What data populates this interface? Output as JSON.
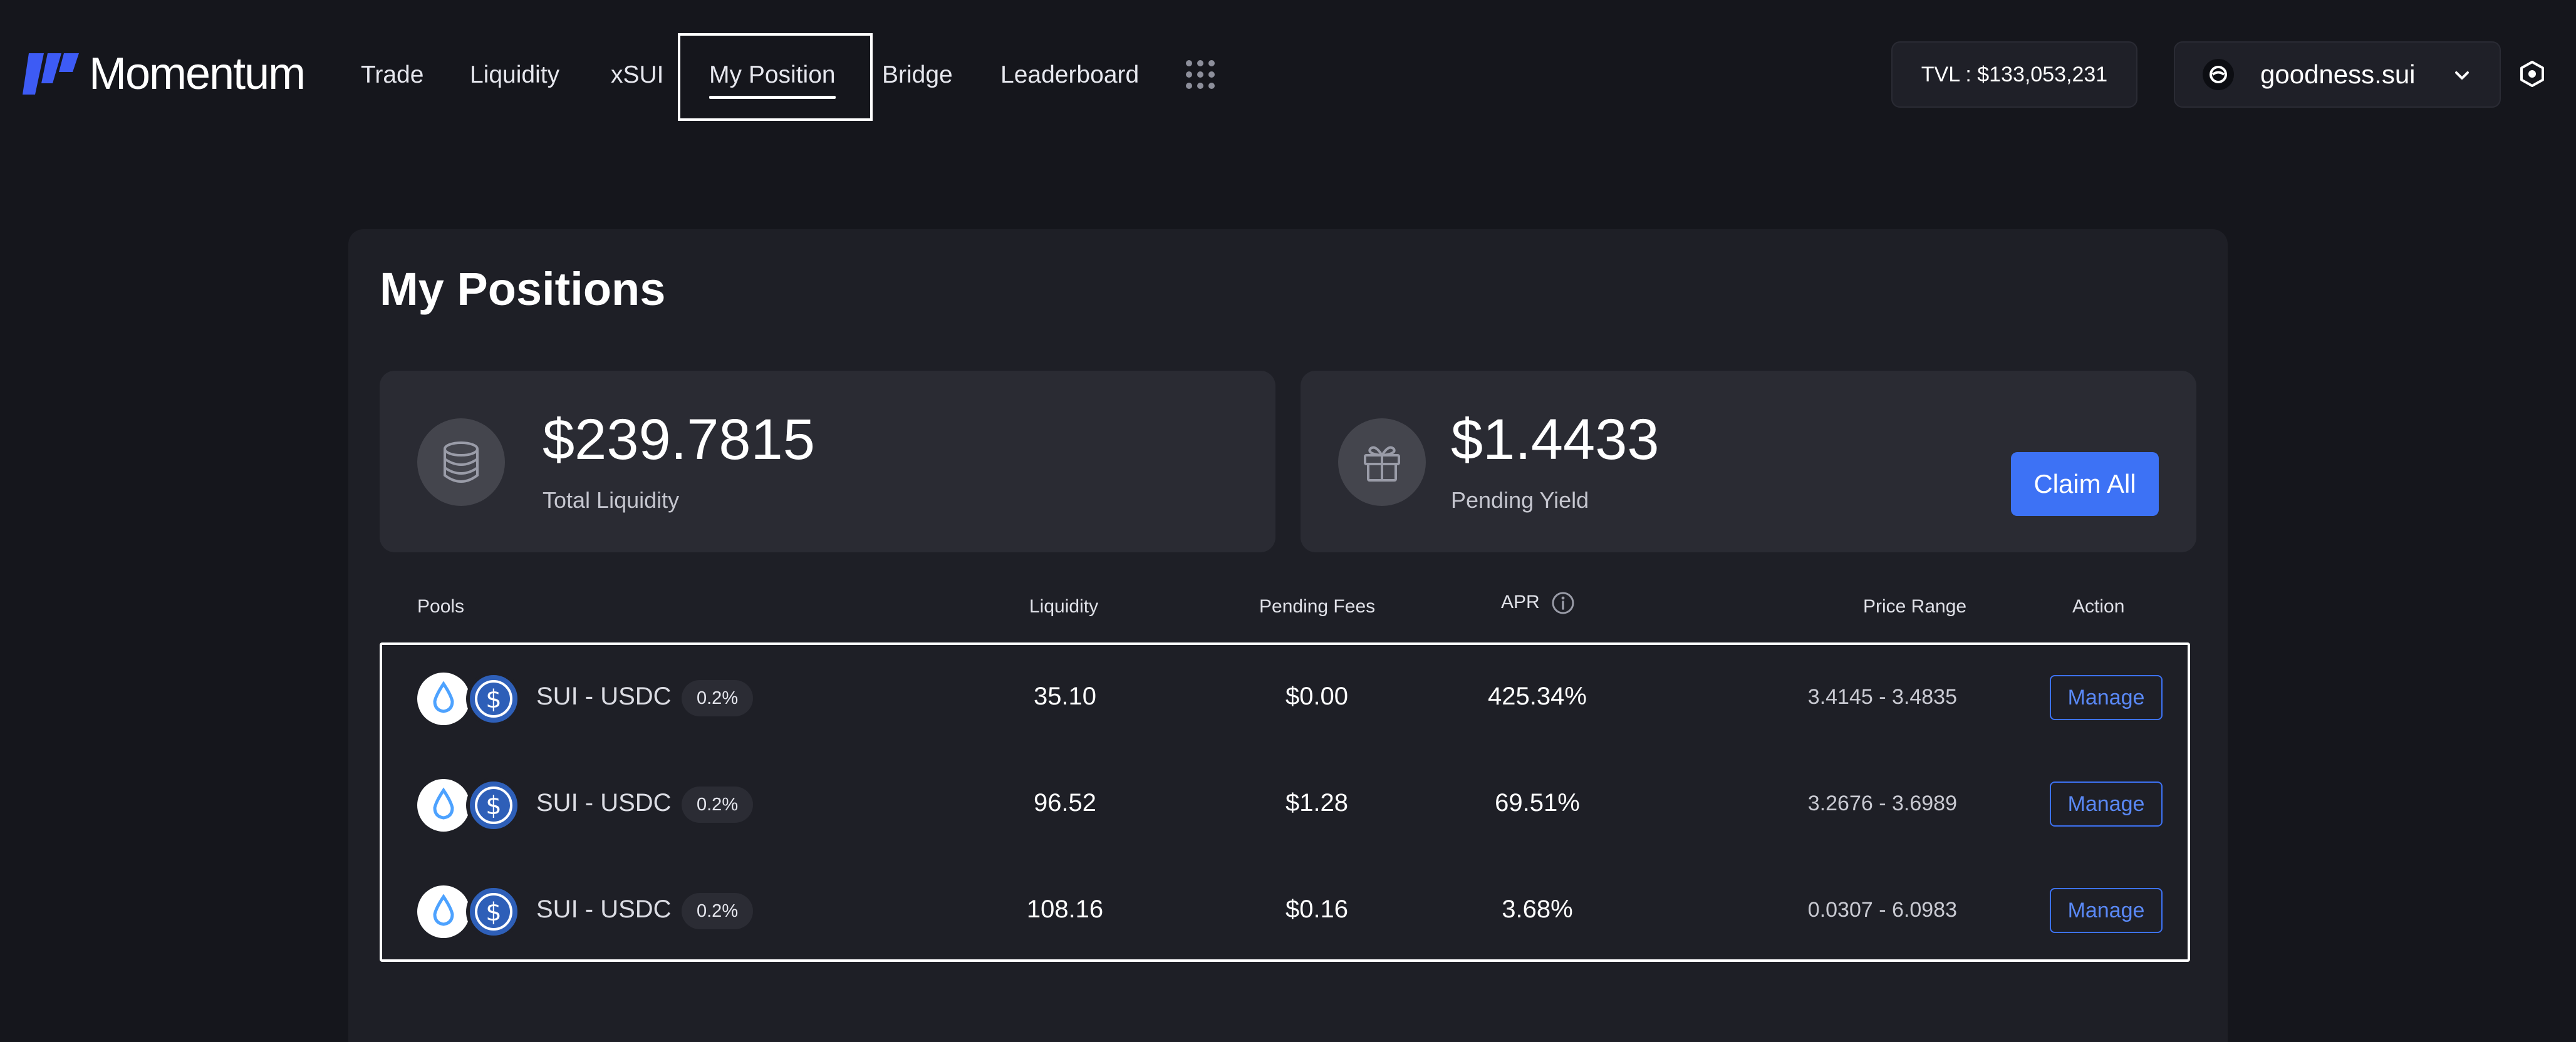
{
  "brand": {
    "name": "Momentum"
  },
  "nav": {
    "items": [
      "Trade",
      "Liquidity",
      "xSUI",
      "My Position",
      "Bridge",
      "Leaderboard"
    ],
    "active": "My Position"
  },
  "header": {
    "tvl": "TVL : $133,053,231",
    "wallet": "goodness.sui"
  },
  "page": {
    "title": "My Positions"
  },
  "stats": {
    "total_liquidity": {
      "value": "$239.7815",
      "label": "Total Liquidity"
    },
    "pending_yield": {
      "value": "$1.4433",
      "label": "Pending Yield"
    },
    "claim_label": "Claim All"
  },
  "table": {
    "headers": {
      "pools": "Pools",
      "liquidity": "Liquidity",
      "pending_fees": "Pending Fees",
      "apr": "APR",
      "price_range": "Price Range",
      "action": "Action"
    },
    "rows": [
      {
        "pair": "SUI - USDC",
        "fee": "0.2%",
        "liquidity": "35.10",
        "pending_fees": "$0.00",
        "apr": "425.34%",
        "price_range": "3.4145 - 3.4835",
        "action": "Manage"
      },
      {
        "pair": "SUI - USDC",
        "fee": "0.2%",
        "liquidity": "96.52",
        "pending_fees": "$1.28",
        "apr": "69.51%",
        "price_range": "3.2676 - 3.6989",
        "action": "Manage"
      },
      {
        "pair": "SUI - USDC",
        "fee": "0.2%",
        "liquidity": "108.16",
        "pending_fees": "$0.16",
        "apr": "3.68%",
        "price_range": "0.0307 - 6.0983",
        "action": "Manage"
      }
    ]
  },
  "colors": {
    "background": "#15161c",
    "panel": "#1e1f26",
    "card": "#2a2b33",
    "accent": "#3d72f5",
    "brand_mark": "#3d5bf5"
  },
  "icons": {
    "logo": "momentum-logo-icon",
    "apps": "apps-grid-icon",
    "wallet": "wallet-avatar-icon",
    "chevron": "chevron-down-icon",
    "settings": "settings-icon",
    "liquidity": "coin-stack-icon",
    "yield": "gift-icon",
    "info": "info-icon",
    "sui": "sui-token-icon",
    "usdc": "usdc-token-icon"
  }
}
